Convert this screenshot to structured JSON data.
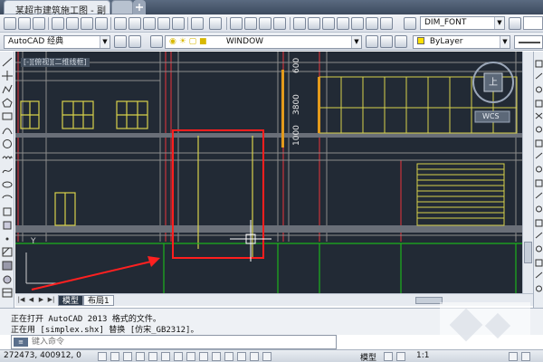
{
  "window": {
    "title": "某超市建筑施工图 - 副本*",
    "new_tab_icon": "plus-icon"
  },
  "toolbar": {
    "workspace": "AutoCAD 经典",
    "layer_name": "WINDOW",
    "font_style": "DIM_FONT",
    "color_control": "ByLayer"
  },
  "drawing": {
    "viewport_label": "[-][俯视][二维线框]",
    "dims": [
      "600",
      "3800",
      "1000"
    ],
    "viewcube_label": "上",
    "wcs_label": "WCS",
    "ucs_y_label": "Y",
    "colors": {
      "background": "#222a35",
      "wall": "#8c8c8c",
      "window": "#d8d24a",
      "axis": "#c8333a",
      "ground": "#1cb21c",
      "highlight": "#ff1e1e"
    }
  },
  "tabs": {
    "model": "模型",
    "layout1": "布局1"
  },
  "command": {
    "history": [
      "正在打开 AutoCAD 2013 格式的文件。",
      "正在用 [simplex.shx] 替换 [仿宋_GB2312]。"
    ],
    "placeholder": "键入命令",
    "icon_label": "≡"
  },
  "status": {
    "coordinates": "272473, 400912, 0",
    "model": "模型",
    "scale": "1:1"
  }
}
